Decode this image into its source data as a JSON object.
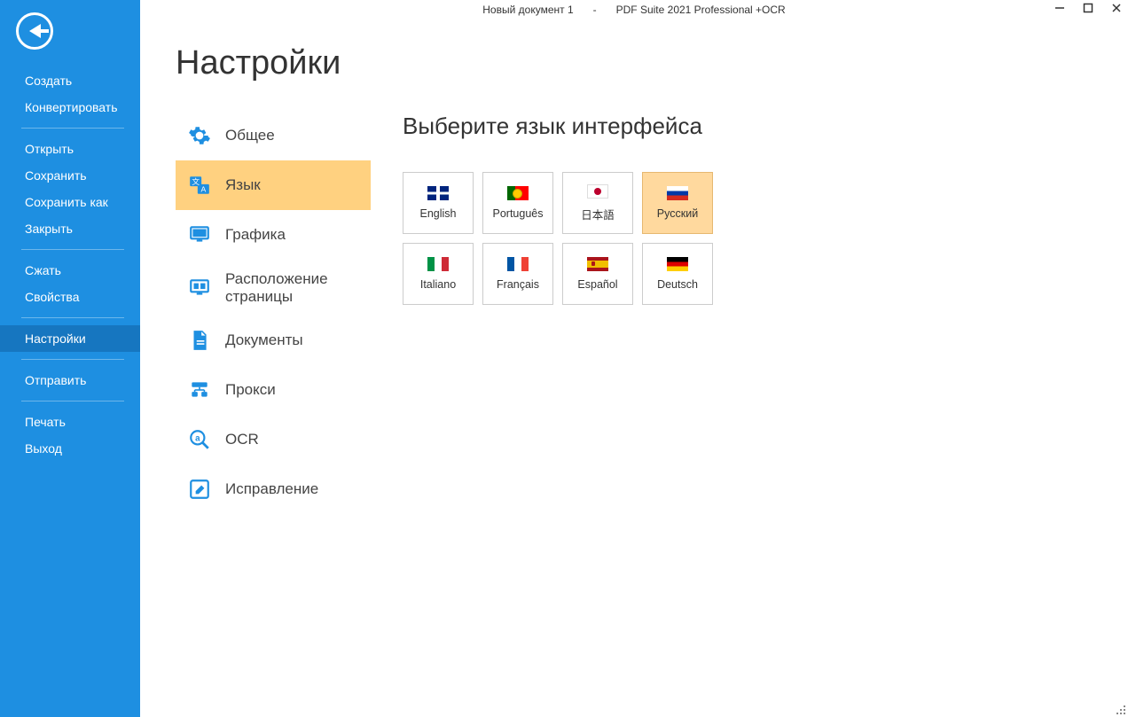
{
  "window": {
    "doc_title": "Новый документ 1",
    "separator": "-",
    "app_title": "PDF Suite 2021 Professional +OCR"
  },
  "sidebar": {
    "items": [
      {
        "label": "Создать"
      },
      {
        "label": "Конвертировать"
      },
      {
        "label": "Открыть"
      },
      {
        "label": "Сохранить"
      },
      {
        "label": "Сохранить как"
      },
      {
        "label": "Закрыть"
      },
      {
        "label": "Сжать"
      },
      {
        "label": "Свойства"
      },
      {
        "label": "Настройки"
      },
      {
        "label": "Отправить"
      },
      {
        "label": "Печать"
      },
      {
        "label": "Выход"
      }
    ]
  },
  "page": {
    "title": "Настройки",
    "panel_title": "Выберите язык интерфейса"
  },
  "tabs": [
    {
      "label": "Общее"
    },
    {
      "label": "Язык"
    },
    {
      "label": "Графика"
    },
    {
      "label": "Расположение страницы"
    },
    {
      "label": "Документы"
    },
    {
      "label": "Прокси"
    },
    {
      "label": "OCR"
    },
    {
      "label": "Исправление"
    }
  ],
  "languages": [
    {
      "label": "English"
    },
    {
      "label": "Português"
    },
    {
      "label": "日本語"
    },
    {
      "label": "Русский"
    },
    {
      "label": "Italiano"
    },
    {
      "label": "Français"
    },
    {
      "label": "Español"
    },
    {
      "label": "Deutsch"
    }
  ]
}
